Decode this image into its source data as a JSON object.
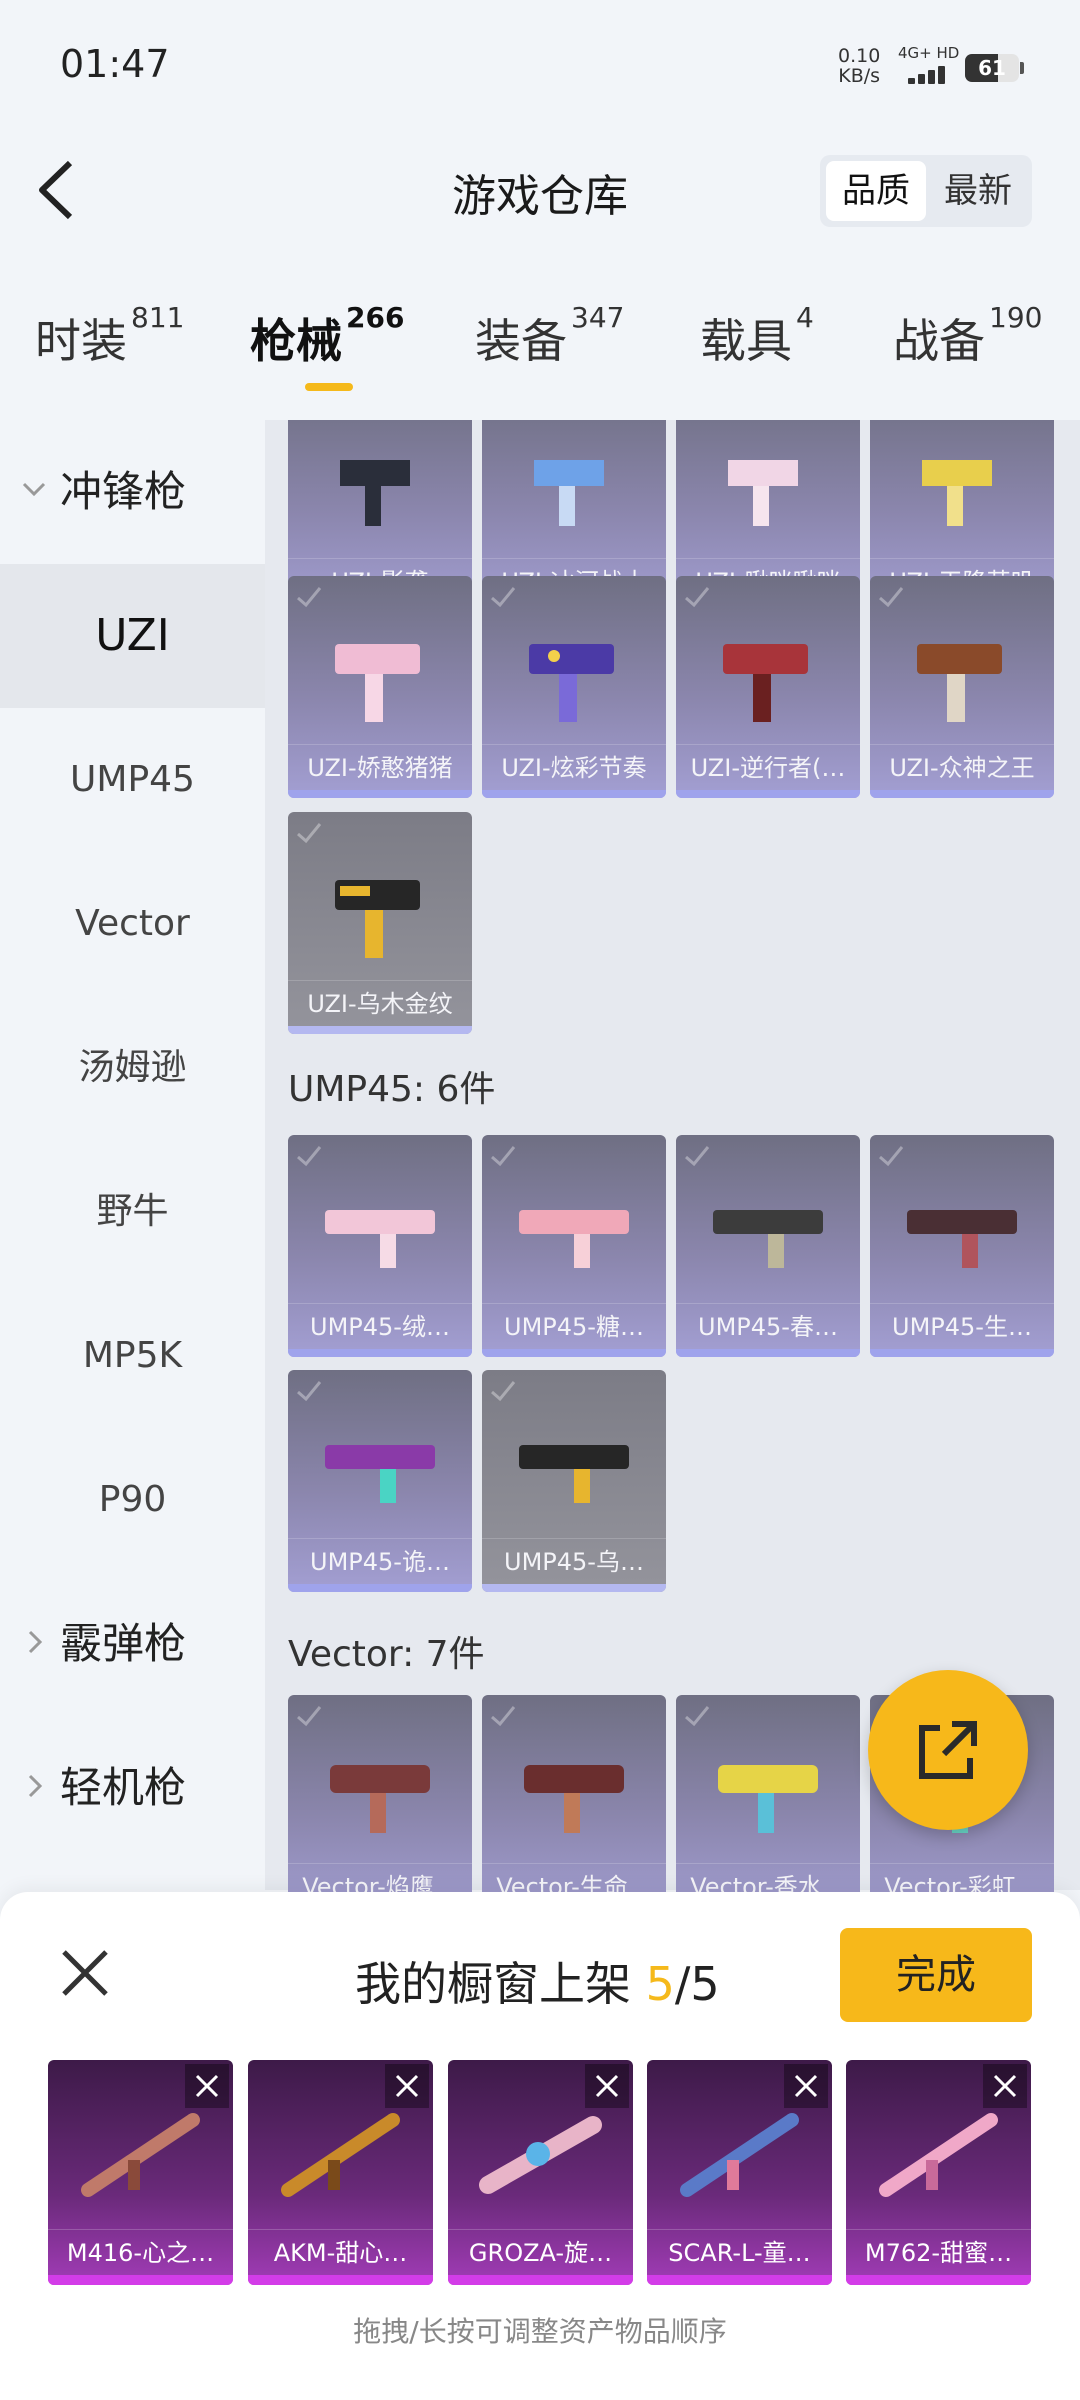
{
  "status": {
    "time": "01:47",
    "speed": "0.10",
    "speed_unit": "KB/s",
    "net_type": "4G+ HD",
    "battery": "61",
    "battery_level": 0.61
  },
  "header": {
    "title": "游戏仓库",
    "sort_options": [
      "品质",
      "最新"
    ],
    "active_sort": "品质"
  },
  "tabs": [
    {
      "label": "时装",
      "count": "811"
    },
    {
      "label": "枪械",
      "count": "266"
    },
    {
      "label": "装备",
      "count": "347"
    },
    {
      "label": "载具",
      "count": "4"
    },
    {
      "label": "战备",
      "count": "190"
    }
  ],
  "sidebar": {
    "group_open": "冲锋枪",
    "items": [
      "UZI",
      "UMP45",
      "Vector",
      "汤姆逊",
      "野牛",
      "MP5K",
      "P90"
    ],
    "active": "UZI",
    "groups_collapsed": [
      "霰弹枪",
      "轻机枪"
    ]
  },
  "uzi_items": [
    "UZI-影袭",
    "UZI-冰河战士",
    "UZI-啾咪啾咪",
    "UZI-天降萌叽",
    "UZI-娇憨猪猪",
    "UZI-炫彩节奏",
    "UZI-逆行者(…",
    "UZI-众神之王",
    "UZI-乌木金纹"
  ],
  "ump_section": "UMP45: 6件",
  "ump_items": [
    "UMP45-绒…",
    "UMP45-糖…",
    "UMP45-春…",
    "UMP45-生…",
    "UMP45-诡…",
    "UMP45-乌…"
  ],
  "vector_section": "Vector: 7件",
  "vector_items": [
    "Vector-焰鹰…",
    "Vector-生命…",
    "Vector-香水…",
    "Vector-彩虹…"
  ],
  "panel": {
    "title_prefix": "我的橱窗上架 ",
    "count": "5",
    "total": "/5",
    "done": "完成",
    "selected": [
      "M416-心之…",
      "AKM-甜心…",
      "GROZA-旋…",
      "SCAR-L-童…",
      "M762-甜蜜…"
    ],
    "hint": "拖拽/长按可调整资产物品顺序"
  }
}
